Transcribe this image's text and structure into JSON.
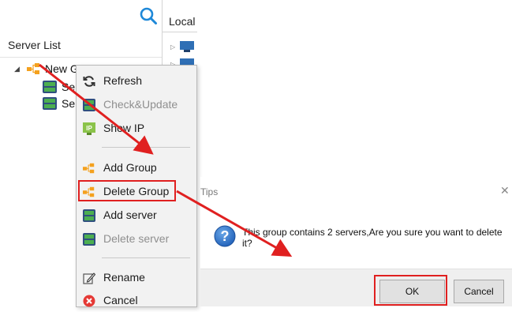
{
  "left_panel": {
    "title": "Server List",
    "tree": {
      "group_label": "New Group",
      "child_1_label": "Ser",
      "child_2_label": "Ser"
    }
  },
  "local_panel": {
    "title": "Local I"
  },
  "context_menu": {
    "items": [
      {
        "label": "Refresh",
        "icon": "refresh-icon",
        "enabled": true
      },
      {
        "label": "Check&Update",
        "icon": "server-icon",
        "enabled": false
      },
      {
        "label": "Show IP",
        "icon": "ip-icon",
        "enabled": true
      },
      {
        "label": "Add Group",
        "icon": "group-icon",
        "enabled": true
      },
      {
        "label": "Delete Group",
        "icon": "group-icon",
        "enabled": true
      },
      {
        "label": "Add server",
        "icon": "server-icon",
        "enabled": true
      },
      {
        "label": "Delete server",
        "icon": "server-icon",
        "enabled": false
      },
      {
        "label": "Rename",
        "icon": "pencil-icon",
        "enabled": true
      },
      {
        "label": "Cancel",
        "icon": "cancel-icon",
        "enabled": true
      }
    ]
  },
  "tips_dialog": {
    "title": "Tips",
    "close_glyph": "✕",
    "message": "This group contains 2 servers,Are you sure you want to delete it?",
    "ok_label": "OK",
    "cancel_label": "Cancel"
  },
  "colors": {
    "accent_blue": "#1e88d8",
    "highlight_red": "#e02020",
    "group_orange": "#f4a11e",
    "server_green": "#2e8b57"
  }
}
